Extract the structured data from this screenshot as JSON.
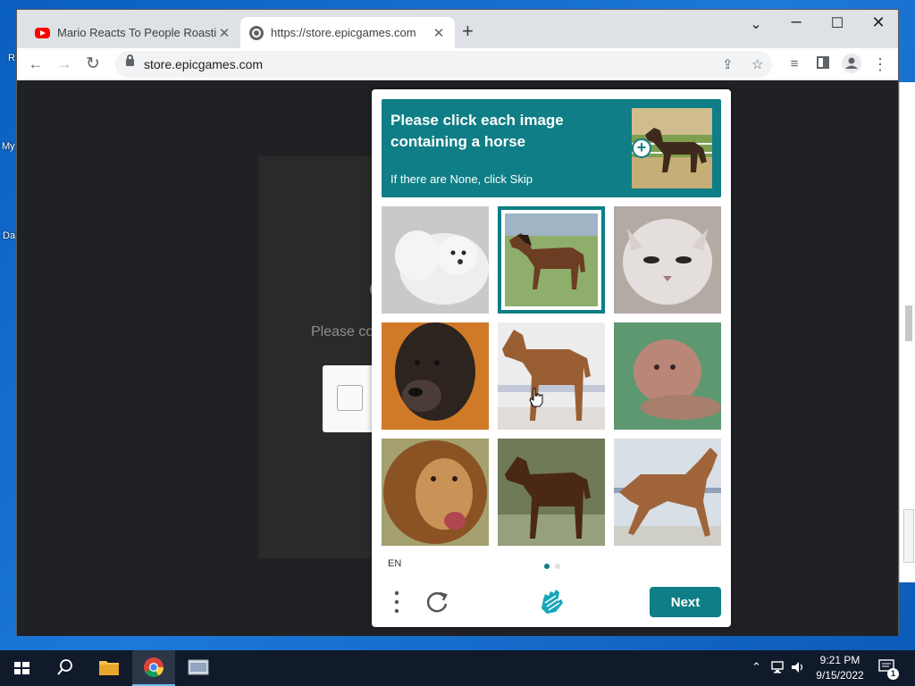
{
  "desktop": {
    "fragments": [
      "R",
      "My",
      "Da"
    ]
  },
  "browser": {
    "tabs": [
      {
        "title": "Mario Reacts To People Roasting",
        "icon": "youtube-icon"
      },
      {
        "title": "https://store.epicgames.com",
        "icon": "globe-icon"
      }
    ],
    "url": "store.epicgames.com"
  },
  "page": {
    "behind_text": "Please co"
  },
  "captcha": {
    "title": "Please click each image containing a horse",
    "subtitle": "If there are None, click Skip",
    "lang": "EN",
    "next_label": "Next",
    "accent": "#0f7e86",
    "images": [
      {
        "subject": "white-dog",
        "selected": false
      },
      {
        "subject": "horse",
        "selected": true
      },
      {
        "subject": "white-cat",
        "selected": false
      },
      {
        "subject": "dark-dog",
        "selected": false
      },
      {
        "subject": "horse",
        "selected": false
      },
      {
        "subject": "lioness",
        "selected": false
      },
      {
        "subject": "lion",
        "selected": false
      },
      {
        "subject": "horse",
        "selected": false
      },
      {
        "subject": "horse",
        "selected": false
      }
    ]
  },
  "taskbar": {
    "time": "9:21 PM",
    "date": "9/15/2022",
    "notification_count": "1"
  }
}
